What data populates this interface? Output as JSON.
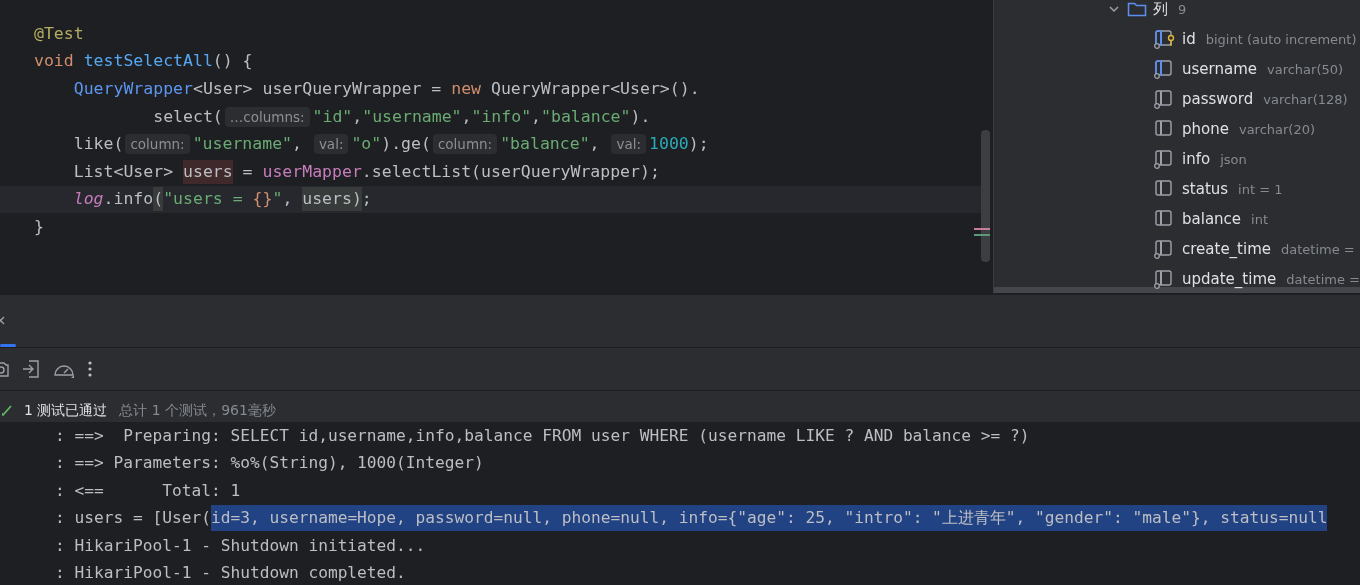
{
  "editor": {
    "lines": [
      {
        "current": false,
        "tokens": [
          {
            "kind": "annotation",
            "text": "@Test"
          }
        ]
      },
      {
        "current": false,
        "tokens": [
          {
            "kind": "keyword",
            "text": "void "
          },
          {
            "kind": "method",
            "text": "testSelectAll"
          },
          {
            "kind": "plain",
            "text": "() {"
          }
        ]
      },
      {
        "current": false,
        "tokens": [
          {
            "kind": "type",
            "text": "    QueryWrapper"
          },
          {
            "kind": "plain",
            "text": "<User> userQueryWrapper = "
          },
          {
            "kind": "keyword",
            "text": "new "
          },
          {
            "kind": "plain",
            "text": "QueryWrapper<User>()."
          }
        ]
      },
      {
        "current": false,
        "tokens": [
          {
            "kind": "plain",
            "text": "            select("
          },
          {
            "kind": "hint",
            "text": "…columns:"
          },
          {
            "kind": "string",
            "text": "\"id\""
          },
          {
            "kind": "plain",
            "text": ","
          },
          {
            "kind": "string",
            "text": "\"username\""
          },
          {
            "kind": "plain",
            "text": ","
          },
          {
            "kind": "string",
            "text": "\"info\""
          },
          {
            "kind": "plain",
            "text": ","
          },
          {
            "kind": "string",
            "text": "\"balance\""
          },
          {
            "kind": "plain",
            "text": ")."
          }
        ]
      },
      {
        "current": false,
        "tokens": [
          {
            "kind": "plain",
            "text": "    like("
          },
          {
            "kind": "hint",
            "text": "column:"
          },
          {
            "kind": "string",
            "text": "\"username\""
          },
          {
            "kind": "plain",
            "text": ", "
          },
          {
            "kind": "hint",
            "text": "val:"
          },
          {
            "kind": "string",
            "text": "\"o\""
          },
          {
            "kind": "plain",
            "text": ").ge("
          },
          {
            "kind": "hint",
            "text": "column:"
          },
          {
            "kind": "string",
            "text": "\"balance\""
          },
          {
            "kind": "plain",
            "text": ", "
          },
          {
            "kind": "hint",
            "text": "val:"
          },
          {
            "kind": "number",
            "text": "1000"
          },
          {
            "kind": "plain",
            "text": ");"
          }
        ]
      },
      {
        "current": false,
        "tokens": [
          {
            "kind": "plain",
            "text": "    List<User> "
          },
          {
            "kind": "write_hl",
            "text": "users"
          },
          {
            "kind": "plain",
            "text": " = "
          },
          {
            "kind": "field",
            "text": "userMapper"
          },
          {
            "kind": "plain",
            "text": ".selectList(userQueryWrapper);"
          }
        ]
      },
      {
        "current": true,
        "tokens": [
          {
            "kind": "static",
            "text": "    log"
          },
          {
            "kind": "plain",
            "text": ".info"
          },
          {
            "kind": "read_hl",
            "text": "("
          },
          {
            "kind": "string",
            "text": "\"users = "
          },
          {
            "kind": "brace",
            "text": "{}"
          },
          {
            "kind": "string",
            "text": "\""
          },
          {
            "kind": "plain",
            "text": ", "
          },
          {
            "kind": "read_hl",
            "text": "users)"
          },
          {
            "kind": "plain",
            "text": ";"
          }
        ]
      },
      {
        "current": false,
        "tokens": [
          {
            "kind": "plain",
            "text": "}"
          }
        ]
      }
    ]
  },
  "database": {
    "folder": {
      "label": "列",
      "count": "9",
      "expanded": true
    },
    "columns": [
      {
        "kind": "primary",
        "name": "id",
        "type": "bigint (auto increment)"
      },
      {
        "kind": "indexed",
        "name": "username",
        "type": "varchar(50)"
      },
      {
        "kind": "not_null",
        "name": "password",
        "type": "varchar(128)"
      },
      {
        "kind": "plain",
        "name": "phone",
        "type": "varchar(20)"
      },
      {
        "kind": "not_null",
        "name": "info",
        "type": "json"
      },
      {
        "kind": "plain",
        "name": "status",
        "type": "int = 1"
      },
      {
        "kind": "plain",
        "name": "balance",
        "type": "int"
      },
      {
        "kind": "not_null",
        "name": "create_time",
        "type": "datetime ="
      },
      {
        "kind": "not_null",
        "name": "update_time",
        "type": "datetime ="
      }
    ]
  },
  "tests": {
    "passed": true,
    "result": "1 测试已通过",
    "summary": "总计 1 个测试，961毫秒"
  },
  "console": {
    "lines": [
      [
        {
          "text": ": ==>  Preparing: SELECT id,username,info,balance FROM user WHERE (username LIKE ? AND balance >= ?)",
          "selected": false
        }
      ],
      [
        {
          "text": ": ==> Parameters: %o%(String), 1000(Integer)",
          "selected": false
        }
      ],
      [
        {
          "text": ": <==      Total: 1",
          "selected": false
        }
      ],
      [
        {
          "text": ": users = [User(",
          "selected": false
        },
        {
          "text": "id=3, username=Hope, password=null, phone=null, info={\"age\": 25, \"intro\": \"上进青年\", \"gender\": \"male\"}, status=null",
          "selected": true
        }
      ],
      [
        {
          "text": ": HikariPool-1 - Shutdown initiated...",
          "selected": false
        }
      ],
      [
        {
          "text": ": HikariPool-1 - Shutdown completed.",
          "selected": false
        }
      ]
    ]
  }
}
